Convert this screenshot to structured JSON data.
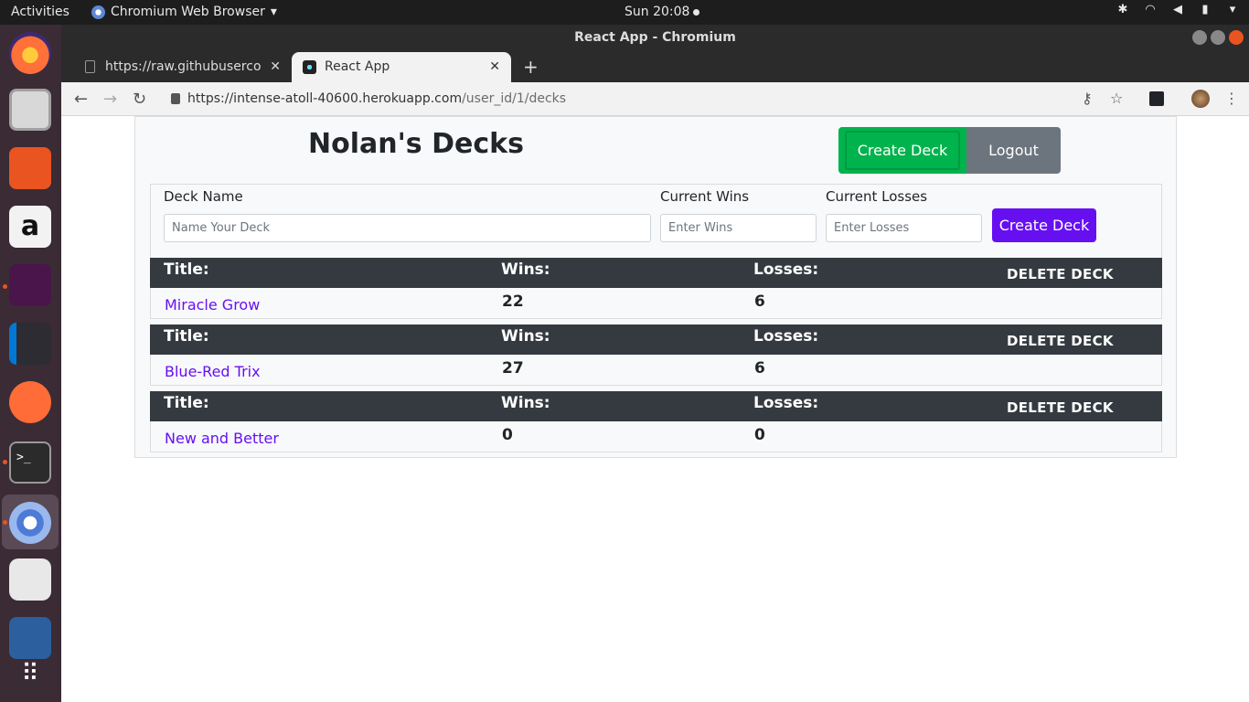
{
  "system": {
    "activities": "Activities",
    "app_menu": "Chromium Web Browser",
    "clock": "Sun 20:08"
  },
  "window": {
    "title": "React App - Chromium",
    "tabs": [
      {
        "label": "https://raw.githubuserco"
      },
      {
        "label": "React App"
      }
    ],
    "url_host": "https://intense-atoll-40600.herokuapp.com",
    "url_path": "/user_id/1/decks"
  },
  "page": {
    "title": "Nolan's Decks",
    "create_deck_button": "Create Deck",
    "logout_button": "Logout",
    "form": {
      "deck_name_label": "Deck Name",
      "deck_name_placeholder": "Name Your Deck",
      "wins_label": "Current Wins",
      "wins_placeholder": "Enter Wins",
      "losses_label": "Current Losses",
      "losses_placeholder": "Enter Losses",
      "submit": "Create Deck"
    },
    "deck_headers": {
      "title": "Title:",
      "wins": "Wins:",
      "losses": "Losses:",
      "delete": "DELETE DECK"
    },
    "decks": [
      {
        "title": "Miracle Grow",
        "wins": "22",
        "losses": "6"
      },
      {
        "title": "Blue-Red Trix",
        "wins": "27",
        "losses": "6"
      },
      {
        "title": "New and Better",
        "wins": "0",
        "losses": "0"
      }
    ]
  },
  "colors": {
    "primary_purple": "#6610f2",
    "success_green": "#00b34d",
    "dark_header": "#343a40"
  }
}
